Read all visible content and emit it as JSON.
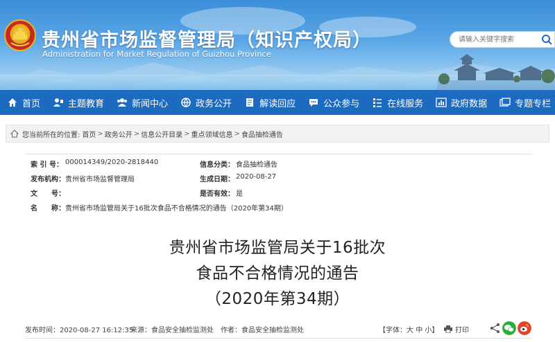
{
  "header": {
    "title": "贵州省市场监督管理局（知识产权局）",
    "subtitle": "Administration for Market Regulation of Guizhou Province",
    "search_placeholder": "请输入关键字搜索"
  },
  "nav": {
    "items": [
      {
        "label": "首页",
        "icon": "home-icon"
      },
      {
        "label": "主题教育",
        "icon": "people-icon"
      },
      {
        "label": "新闻中心",
        "icon": "group-icon"
      },
      {
        "label": "政务公开",
        "icon": "globe-icon"
      },
      {
        "label": "解读回应",
        "icon": "book-icon"
      },
      {
        "label": "公众参与",
        "icon": "chat-icon"
      },
      {
        "label": "在线服务",
        "icon": "list-icon"
      },
      {
        "label": "政府数据",
        "icon": "chart-icon"
      },
      {
        "label": "专题专栏",
        "icon": "folder-icon"
      }
    ]
  },
  "breadcrumb": {
    "prefix": "您当前所在的位置:",
    "items": [
      "首页",
      "政务公开",
      "信息公开目录",
      "重点领域信息",
      "食品抽检通告"
    ]
  },
  "info": {
    "index_label": "索 引 号：",
    "index_value": "000014349/2020-2818440",
    "category_label": "信息分类：",
    "category_value": "食品抽检通告",
    "publisher_label": "发布机构：",
    "publisher_value": "贵州省市场监督管理局",
    "date_label": "生成日期：",
    "date_value": "2020-08-27",
    "docno_label": "文　　号：",
    "docno_value": "",
    "valid_label": "是否有效：",
    "valid_value": "是",
    "name_label": "名　　称：",
    "name_value": "贵州省市场监管局关于16批次食品不合格情况的通告（2020年第34期）"
  },
  "article": {
    "title_line1": "贵州省市场监管局关于16批次",
    "title_line2": "食品不合格情况的通告",
    "title_line3": "（2020年第34期）"
  },
  "meta": {
    "publish_time": "发布时间：2020-08-27 16:12:35",
    "source": "来源：食品安全抽检监测处",
    "author": "作者：食品安全抽检监测处",
    "font_prefix": "【字体：",
    "font_large": "大",
    "font_medium": "中",
    "font_small": "小",
    "font_suffix": "】",
    "print": "打印",
    "share_icons": [
      "share-icon",
      "wechat-icon",
      "weibo-icon"
    ]
  },
  "colors": {
    "nav_bg": "#1d6bc0",
    "banner_top": "#3a8ed8",
    "wechat": "#2bad3a",
    "weibo": "#e6412b"
  }
}
